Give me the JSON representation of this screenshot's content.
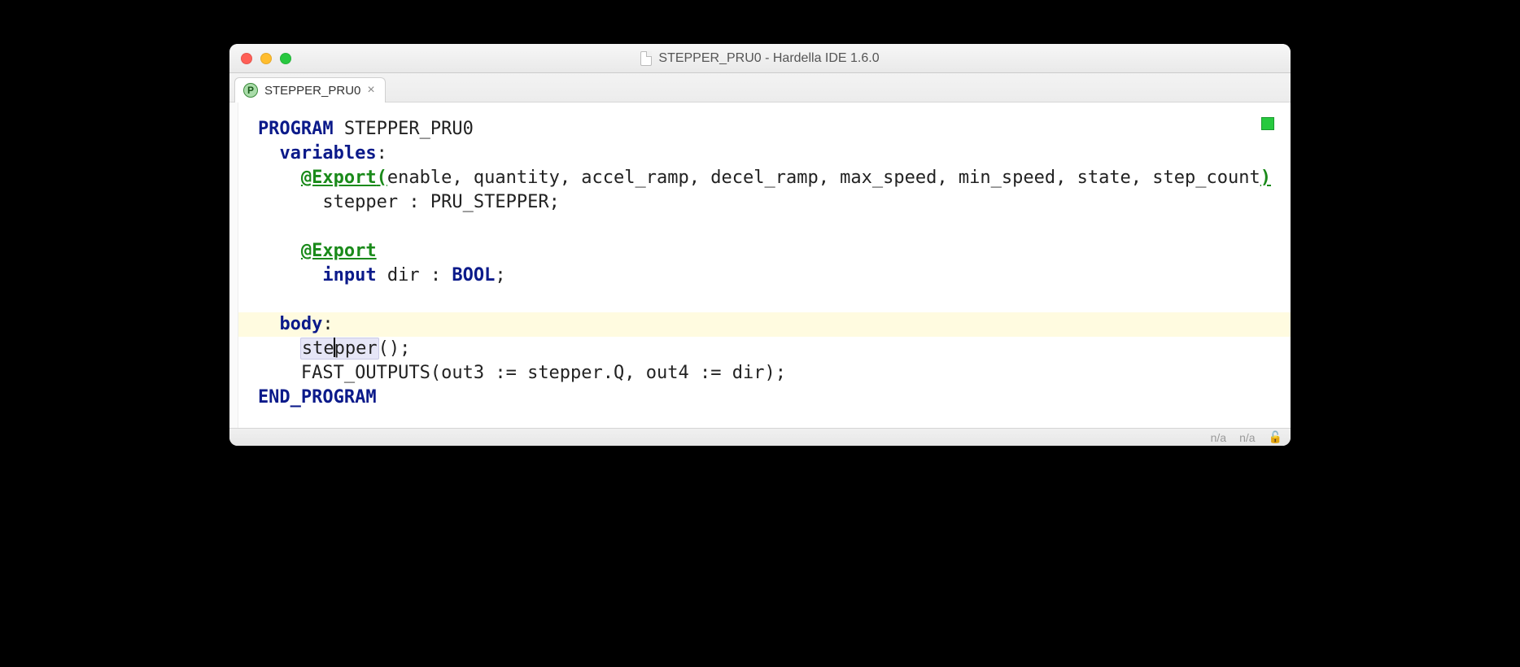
{
  "window": {
    "title": "STEPPER_PRU0 - Hardella IDE 1.6.0"
  },
  "tab": {
    "label": "STEPPER_PRU0"
  },
  "code": {
    "kw_program": "PROGRAM",
    "program_name": "STEPPER_PRU0",
    "kw_variables": "variables",
    "ann_export": "@Export",
    "export_paren_open": "(",
    "export_args": "enable, quantity, accel_ramp, decel_ramp, max_speed, min_speed, state, step_count",
    "export_paren_close": ")",
    "var_stepper_decl": "stepper : PRU_STEPPER;",
    "kw_input": "input",
    "dir_decl_mid": "dir : ",
    "kw_bool": "BOOL",
    "semicolon": ";",
    "kw_body": "body",
    "body_stepper_pre": "ste",
    "body_stepper_post": "pper",
    "body_stepper_tail": "();",
    "body_fastout": "FAST_OUTPUTS(out3 := stepper.Q, out4 := dir);",
    "kw_endprogram": "END_PROGRAM"
  },
  "status": {
    "na1": "n/a",
    "na2": "n/a"
  }
}
